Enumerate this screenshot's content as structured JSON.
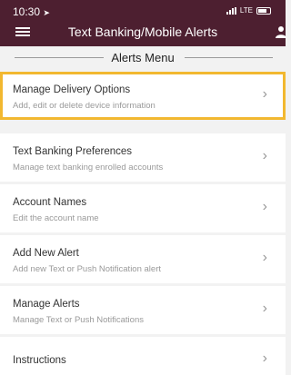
{
  "status": {
    "time": "10:30",
    "carrier": "LTE"
  },
  "header": {
    "title": "Text Banking/Mobile Alerts"
  },
  "section": {
    "title": "Alerts Menu"
  },
  "items": [
    {
      "title": "Manage Delivery Options",
      "subtitle": "Add, edit or delete device information",
      "highlighted": true
    },
    {
      "title": "Text Banking Preferences",
      "subtitle": "Manage text banking enrolled accounts"
    },
    {
      "title": "Account Names",
      "subtitle": "Edit the account name"
    },
    {
      "title": "Add New Alert",
      "subtitle": "Add new Text or Push Notification alert"
    },
    {
      "title": "Manage Alerts",
      "subtitle": "Manage Text or Push Notifications"
    },
    {
      "title": "Instructions",
      "subtitle": ""
    }
  ],
  "colors": {
    "header_bg": "#4d1f30",
    "highlight": "#f2b830"
  }
}
